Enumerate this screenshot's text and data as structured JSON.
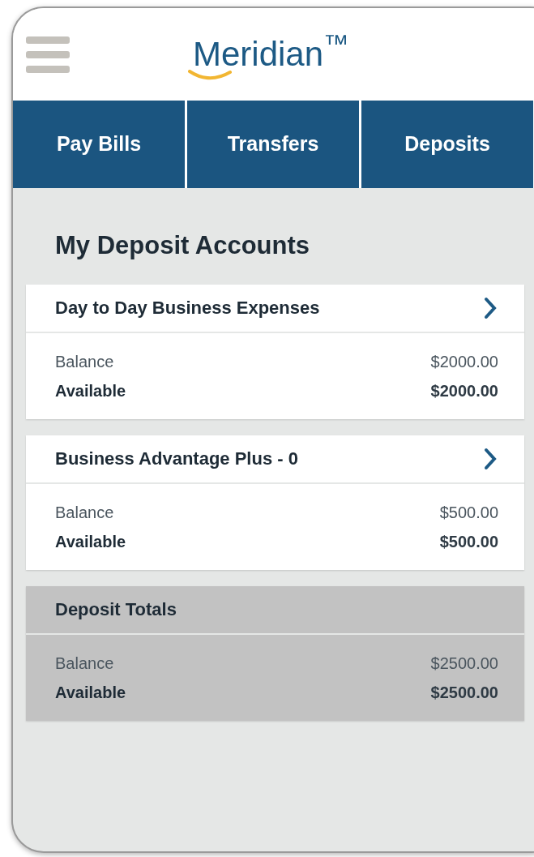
{
  "header": {
    "logo": "Meridian$^{™}$"
  },
  "tabs": [
    {
      "label": "Pay Bills"
    },
    {
      "label": "Transfers"
    },
    {
      "label": "Deposits"
    }
  ],
  "title": "My Deposit Accounts",
  "accounts": [
    {
      "kind": "account",
      "name": "Day to Day Business Expenses",
      "balance_label": "Balance",
      "balance": "$2000.00",
      "available_label": "Available",
      "available": "$2000.00"
    },
    {
      "kind": "account",
      "name": "Business Advantage Plus - 0",
      "balance_label": "Balance",
      "balance": "$500.00",
      "available_label": "Available",
      "available": "$500.00"
    },
    {
      "kind": "totals",
      "name": "Deposit Totals",
      "balance_label": "Balance",
      "balance": "$2500.00",
      "available_label": "Available",
      "available": "$2500.00"
    }
  ]
}
